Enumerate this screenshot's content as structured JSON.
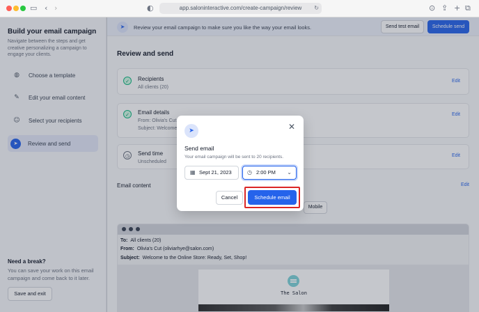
{
  "browser": {
    "url": "app.saloninteractive.com/create-campaign/review"
  },
  "sidebar": {
    "title": "Build your email campaign",
    "description": "Navigate between the steps and get creative personalizing a campaign to engage your clients.",
    "steps": [
      {
        "label": "Choose a template",
        "icon": "palette-icon"
      },
      {
        "label": "Edit your email content",
        "icon": "pencil-icon"
      },
      {
        "label": "Select your recipients",
        "icon": "users-icon"
      },
      {
        "label": "Review and send",
        "icon": "send-icon",
        "active": true
      }
    ],
    "break_title": "Need a break?",
    "break_text": "You can save your work on this email campaign and come back to it later.",
    "save_exit_label": "Save and exit"
  },
  "banner": {
    "text": "Review your email campaign to make sure you like the way your email looks.",
    "send_test_label": "Send test email",
    "schedule_label": "Schedule send"
  },
  "main": {
    "page_title": "Review and send",
    "cards": {
      "recipients": {
        "title": "Recipients",
        "subtitle": "All clients (20)",
        "edit": "Edit"
      },
      "email_details": {
        "title": "Email details",
        "from": "From: Olivia's Cut (o",
        "subject": "Subject: Welcome t",
        "edit": "Edit"
      },
      "send_time": {
        "title": "Send time",
        "subtitle": "Unscheduled",
        "edit": "Edit"
      }
    },
    "content_label": "Email content",
    "content_edit": "Edit",
    "mobile_label": "Mobile",
    "preview": {
      "to_label": "To:",
      "to_value": "All clients (20)",
      "from_label": "From:",
      "from_value": "Olivia's Cut (oliviarhye@salon.com)",
      "subject_label": "Subject:",
      "subject_value": "Welcome to the Online Store: Ready, Set, Shop!",
      "salon_name": "The Salon"
    }
  },
  "modal": {
    "title": "Send email",
    "subtitle": "Your email campaign will be sent to 20 recipients.",
    "date_value": "Sept 21, 2023",
    "time_value": "2:00 PM",
    "cancel_label": "Cancel",
    "schedule_label": "Schedule email"
  },
  "colors": {
    "accent": "#2563eb",
    "highlight": "#dc2626",
    "success": "#10b981"
  }
}
